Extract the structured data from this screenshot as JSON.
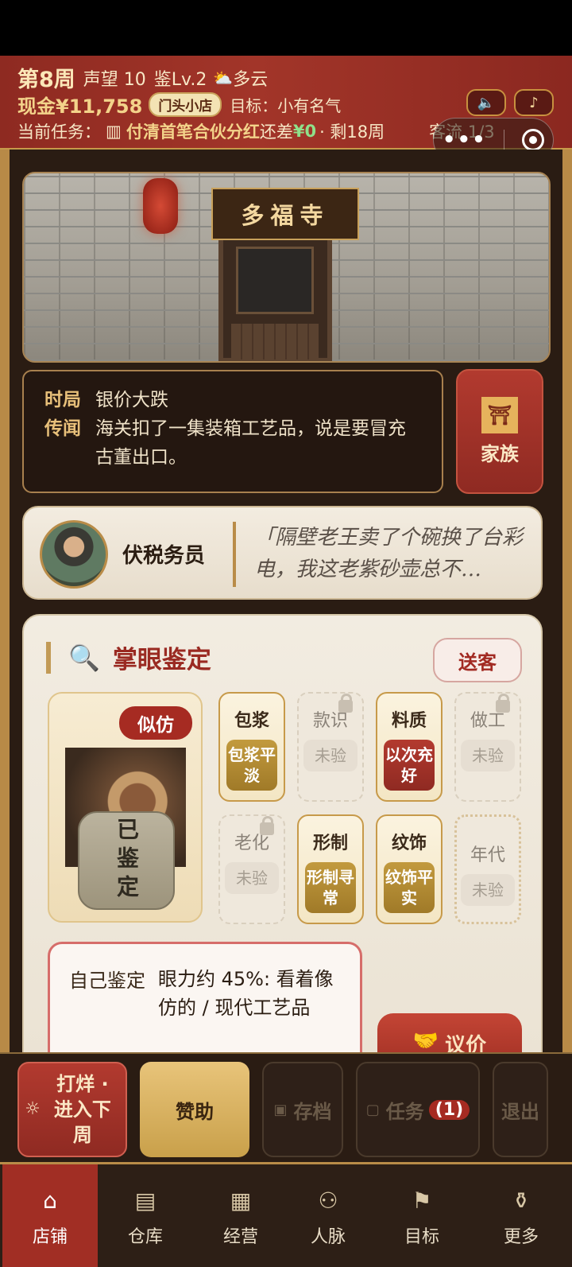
{
  "header": {
    "week": "第8周",
    "reputation": "声望 10",
    "appraise_level": "鉴Lv.2",
    "weather_icon": "cloud-sun-icon",
    "weather": "多云",
    "cash": "现金¥11,758",
    "shop_tier": "门头小店",
    "goal": "目标：小有名气",
    "task_label": "当前任务：",
    "task_name": "付清首笔合伙分红",
    "task_short": "还差",
    "task_amount": "¥0",
    "task_remaining": "· 剩18周",
    "customers": "客流 1/3"
  },
  "shop": {
    "sign": "多福寺"
  },
  "news": {
    "situation_label": "时局",
    "situation": "银价大跌",
    "rumor_label": "传闻",
    "rumor": "海关扣了一集装箱工艺品，说是要冒充古董出口。"
  },
  "family_button": "家族",
  "customer": {
    "name": "伏税务员",
    "quote": "「隔壁老王卖了个碗换了台彩电，我这老紫砂壶总不…"
  },
  "appraisal": {
    "title": "掌眼鉴定",
    "send_off": "送客",
    "verdict_badge": "似仿",
    "appraised": "已鉴定",
    "cards": [
      {
        "label": "包浆",
        "value": "包浆平淡",
        "state": "gold"
      },
      {
        "label": "款识",
        "value": "未验",
        "state": "locked"
      },
      {
        "label": "料质",
        "value": "以次充好",
        "state": "red"
      },
      {
        "label": "做工",
        "value": "未验",
        "state": "locked"
      },
      {
        "label": "老化",
        "value": "未验",
        "state": "locked"
      },
      {
        "label": "形制",
        "value": "形制寻常",
        "state": "gold"
      },
      {
        "label": "纹饰",
        "value": "纹饰平实",
        "state": "gold"
      },
      {
        "label": "年代",
        "value": "未验",
        "state": "locked"
      }
    ],
    "self_label": "自己鉴定",
    "self_result": "眼力约 45%: 看着像仿的 / 现代工艺品",
    "bargain": "议价"
  },
  "actions": {
    "next_week": "打烊 · 进入下周",
    "sponsor": "赞助",
    "save": "存档",
    "tasks": "任务",
    "tasks_count": "(1)",
    "exit": "退出"
  },
  "nav": [
    {
      "label": "店铺",
      "icon": "shop-icon",
      "active": true
    },
    {
      "label": "仓库",
      "icon": "warehouse-icon",
      "active": false
    },
    {
      "label": "经营",
      "icon": "abacus-icon",
      "active": false
    },
    {
      "label": "人脉",
      "icon": "people-icon",
      "active": false
    },
    {
      "label": "目标",
      "icon": "scroll-icon",
      "active": false
    },
    {
      "label": "更多",
      "icon": "vase-icon",
      "active": false
    }
  ]
}
